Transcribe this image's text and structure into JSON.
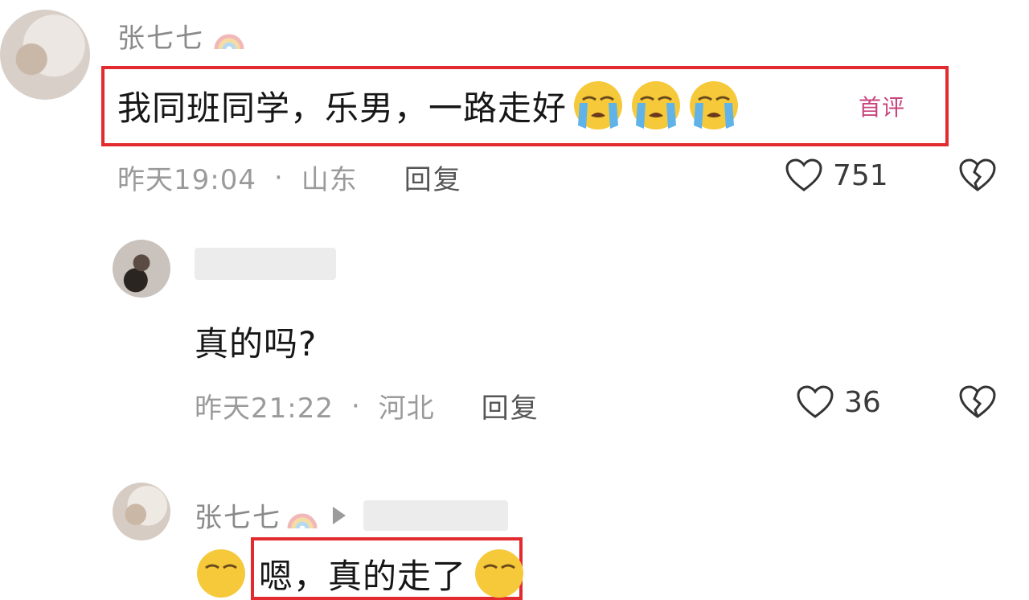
{
  "comment": {
    "username": "张七七",
    "text": "我同班同学，乐男，一路走好",
    "badge": "首评",
    "time": "昨天19:04",
    "sep": "·",
    "location": "山东",
    "reply_label": "回复",
    "likes": "751"
  },
  "reply1": {
    "text": "真的吗?",
    "time": "昨天21:22",
    "sep": "·",
    "location": "河北",
    "reply_label": "回复",
    "likes": "36"
  },
  "reply2": {
    "username": "张七七",
    "text": "嗯，真的走了"
  },
  "colors": {
    "highlight_box": "#e22a2f",
    "badge": "#c9447e",
    "meta": "#9a9a9a"
  },
  "icons": [
    "rainbow-badge-icon",
    "crying-emoji-icon",
    "heart-icon",
    "broken-heart-icon",
    "play-icon"
  ]
}
